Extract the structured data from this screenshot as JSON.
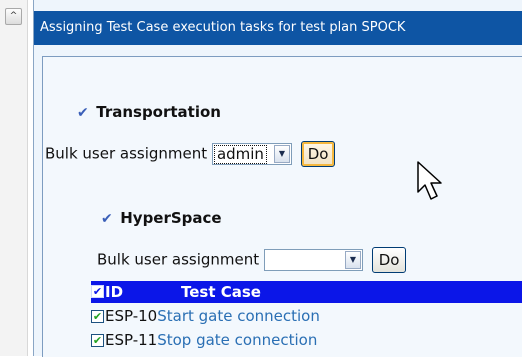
{
  "title": "Assigning Test Case execution tasks for test plan SPOCK",
  "scroll_up_glyph": "^",
  "sections": [
    {
      "name": "Transportation",
      "bulk_label": "Bulk user assignment",
      "selected_user": "admin",
      "do_label": "Do"
    },
    {
      "name": "HyperSpace",
      "bulk_label": "Bulk user assignment",
      "selected_user": "",
      "do_label": "Do"
    }
  ],
  "table": {
    "col_id": "ID",
    "col_test_case": "Test Case",
    "rows": [
      {
        "id": "ESP-10",
        "test_case": "Start gate connection"
      },
      {
        "id": "ESP-11",
        "test_case": "Stop gate connection"
      }
    ]
  },
  "icons": {
    "section_check": "check-icon",
    "dropdown": "chevron-down-icon",
    "cursor": "mouse-pointer-icon"
  },
  "colors": {
    "title_bar": "#0e55a4",
    "table_header": "#0b16e8",
    "link": "#2a6fb4"
  }
}
